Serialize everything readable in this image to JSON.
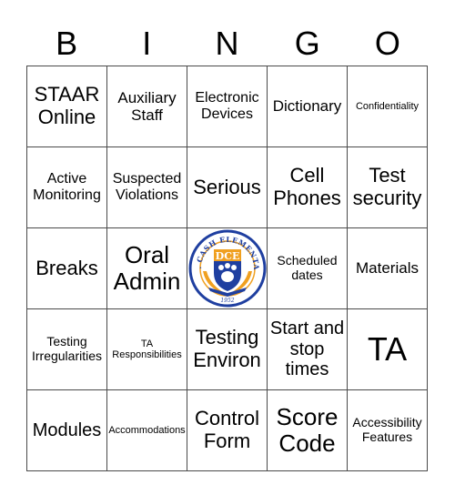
{
  "header": {
    "letters": [
      "B",
      "I",
      "N",
      "G",
      "O"
    ]
  },
  "rows": [
    [
      "STAAR Online",
      "Auxiliary Staff",
      "Electronic Devices",
      "Dictionary",
      "Confidentiality"
    ],
    [
      "Active Monitoring",
      "Suspected Violations",
      "Serious",
      "Cell Phones",
      "Test security"
    ],
    [
      "Breaks",
      "Oral Admin",
      "",
      "Scheduled dates",
      "Materials"
    ],
    [
      "Testing Irregularities",
      "TA Responsibilities",
      "Testing Environ",
      "Start and stop times",
      "TA"
    ],
    [
      "Modules",
      "Accommodations",
      "Control Form",
      "Score Code",
      "Accessibility Features"
    ]
  ],
  "free_space": {
    "logo_text": "DR. CASH ELEMENTARY",
    "logo_initials": "DCE",
    "logo_year": "1952",
    "colors": {
      "blue": "#1f3fa0",
      "orange": "#f0a020"
    }
  }
}
